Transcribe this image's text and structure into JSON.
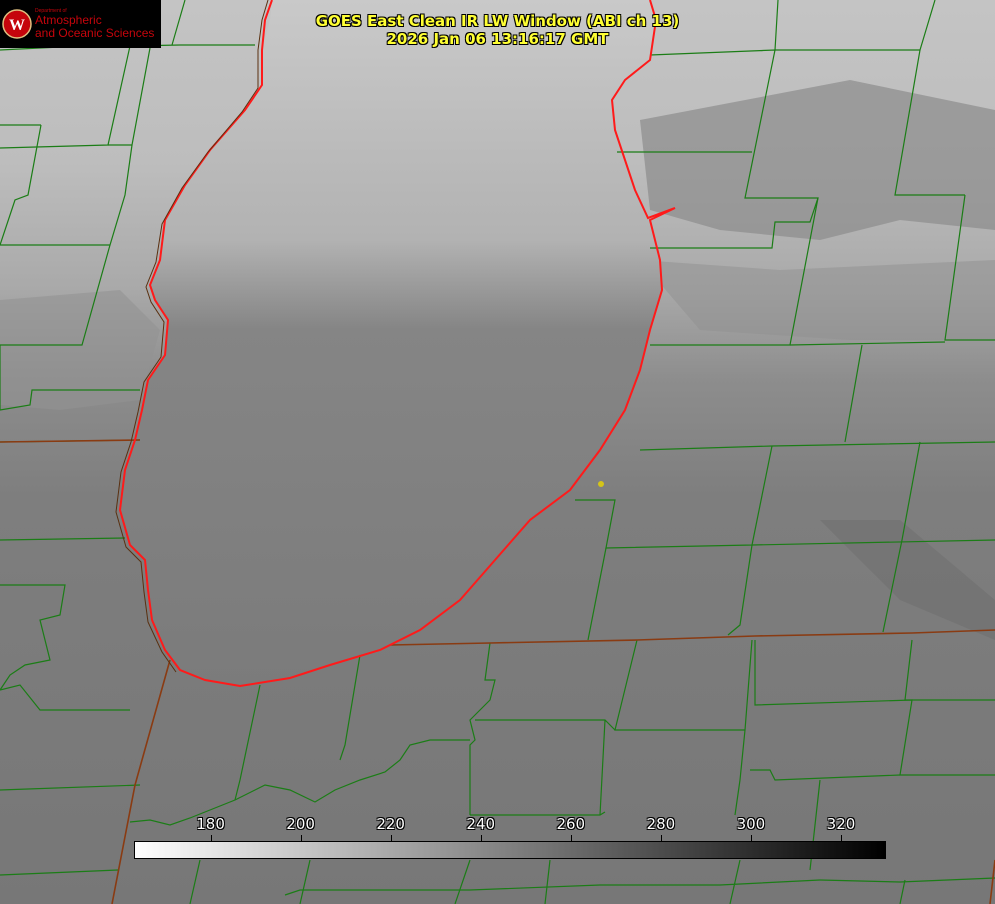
{
  "logo": {
    "dept": "Department of",
    "line1": "Atmospheric",
    "line2": "and Oceanic Sciences",
    "seal_letter": "W"
  },
  "title": {
    "line1": "GOES East Clean IR LW Window (ABI ch 13)",
    "line2": "2026 Jan 06 13:16:17 GMT"
  },
  "colorbar": {
    "min": 163,
    "max": 330,
    "ticks": [
      180,
      200,
      220,
      240,
      260,
      280,
      300,
      320
    ],
    "colors": {
      "cold": "#ffffff",
      "warm": "#000000"
    }
  },
  "colors": {
    "county_lines": "#1b7d16",
    "state_lines": "#8a3b12",
    "shoreline": "#ff1a1a",
    "marker": "#d4c418",
    "title_text": "#ffff33"
  }
}
